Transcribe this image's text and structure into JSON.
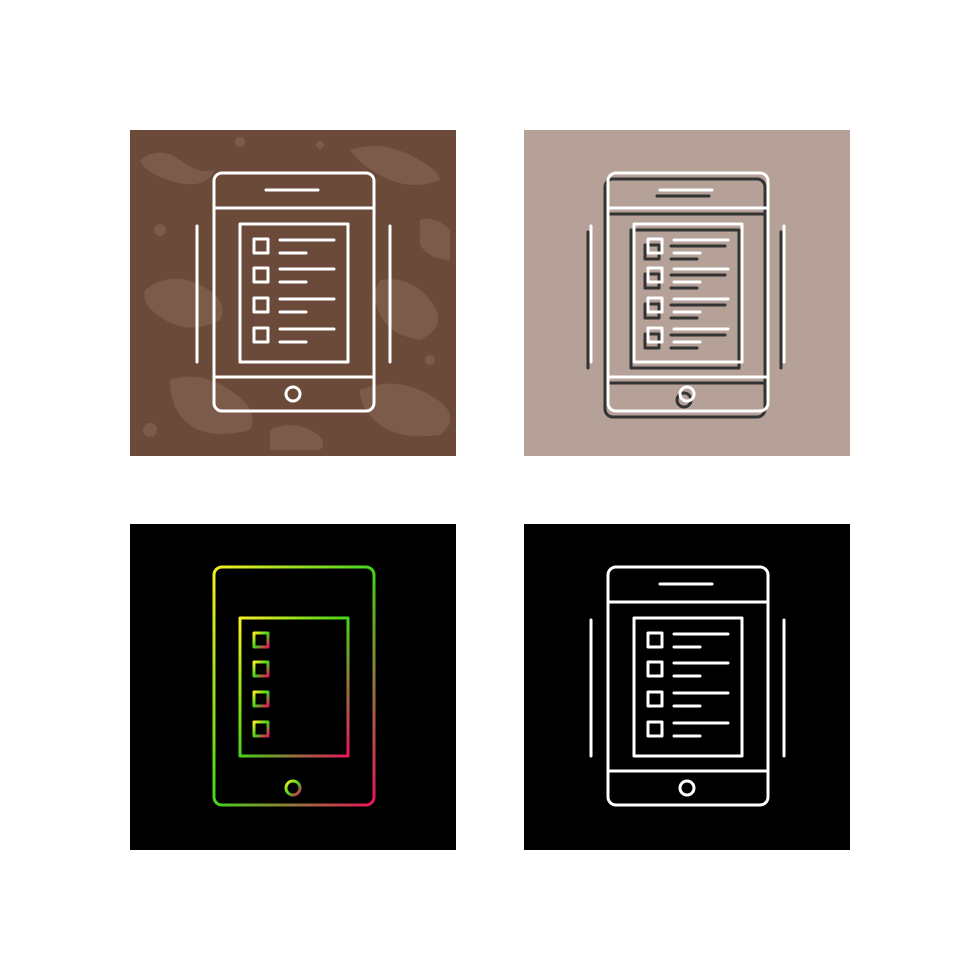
{
  "variants": [
    {
      "id": "grunge",
      "icon": "tablet-checklist-icon",
      "background": "#6b4a3a",
      "background_texture": "#8a6a58",
      "stroke": "#ffffff"
    },
    {
      "id": "shadowed",
      "icon": "tablet-checklist-icon",
      "background": "#b5a197",
      "stroke": "#ffffff",
      "shadow": "#333333"
    },
    {
      "id": "gradient",
      "icon": "tablet-checklist-icon",
      "background": "#000000",
      "gradient_start": "#f5ee25",
      "gradient_mid": "#44d41b",
      "gradient_end": "#e8145a"
    },
    {
      "id": "outline",
      "icon": "tablet-checklist-icon",
      "background": "#000000",
      "stroke": "#ffffff"
    }
  ]
}
